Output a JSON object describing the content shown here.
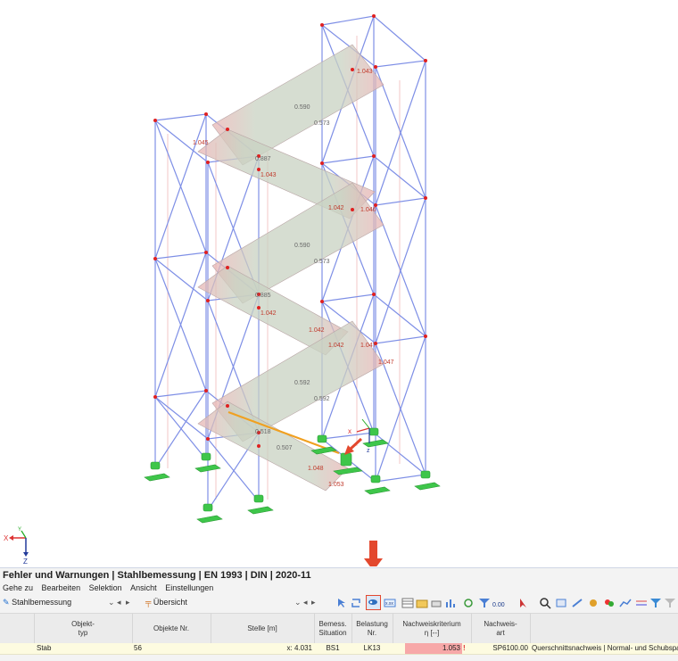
{
  "model": {
    "labels": [
      "1.043",
      "0.590",
      "0.573",
      "1.045",
      "0.887",
      "1.043",
      "1.042",
      "1.046",
      "0.590",
      "0.573",
      "0.885",
      "1.042",
      "1.042",
      "1.042",
      "1.047",
      "1.047",
      "0.592",
      "0.592",
      "0.518",
      "0.507",
      "1.048",
      "1.053"
    ]
  },
  "panel": {
    "title": "Fehler und Warnungen | Stahlbemessung | EN 1993 | DIN | 2020-11",
    "menu": [
      "Gehe zu",
      "Bearbeiten",
      "Selektion",
      "Ansicht",
      "Einstellungen"
    ],
    "module_select": "Stahlbemessung",
    "view_select": "Übersicht",
    "columns": {
      "objekt_typ": [
        "Objekt-",
        "typ"
      ],
      "objekte_nr": "Objekte Nr.",
      "stelle": "Stelle [m]",
      "bemess": [
        "Bemess.",
        "Situation"
      ],
      "belastung": [
        "Belastung",
        "Nr."
      ],
      "nachweiskriterium": [
        "Nachweiskriterium",
        "η [--]"
      ],
      "nachweisart": [
        "Nachweis-",
        "art"
      ]
    },
    "row": {
      "typ": "Stab",
      "nr": "56",
      "stelle": "x: 4.031",
      "situation": "BS1",
      "belastung": "LK13",
      "eta": "1.053",
      "art": "SP6100.00",
      "beschreibung": "Querschnittsnachweis | Normal- und Schubspannung"
    }
  },
  "colors": {
    "accent": "#0078d4",
    "arrow": "#e3482e",
    "fail_cell": "#f7a8a8",
    "support": "#3ec64a",
    "frame": "#7e8fe6"
  },
  "icons": [
    "cursor-select-icon",
    "rotate-select-icon",
    "result-table-icon",
    "values-icon",
    "chart-icon",
    "filter-icon",
    "zoom-icon"
  ]
}
